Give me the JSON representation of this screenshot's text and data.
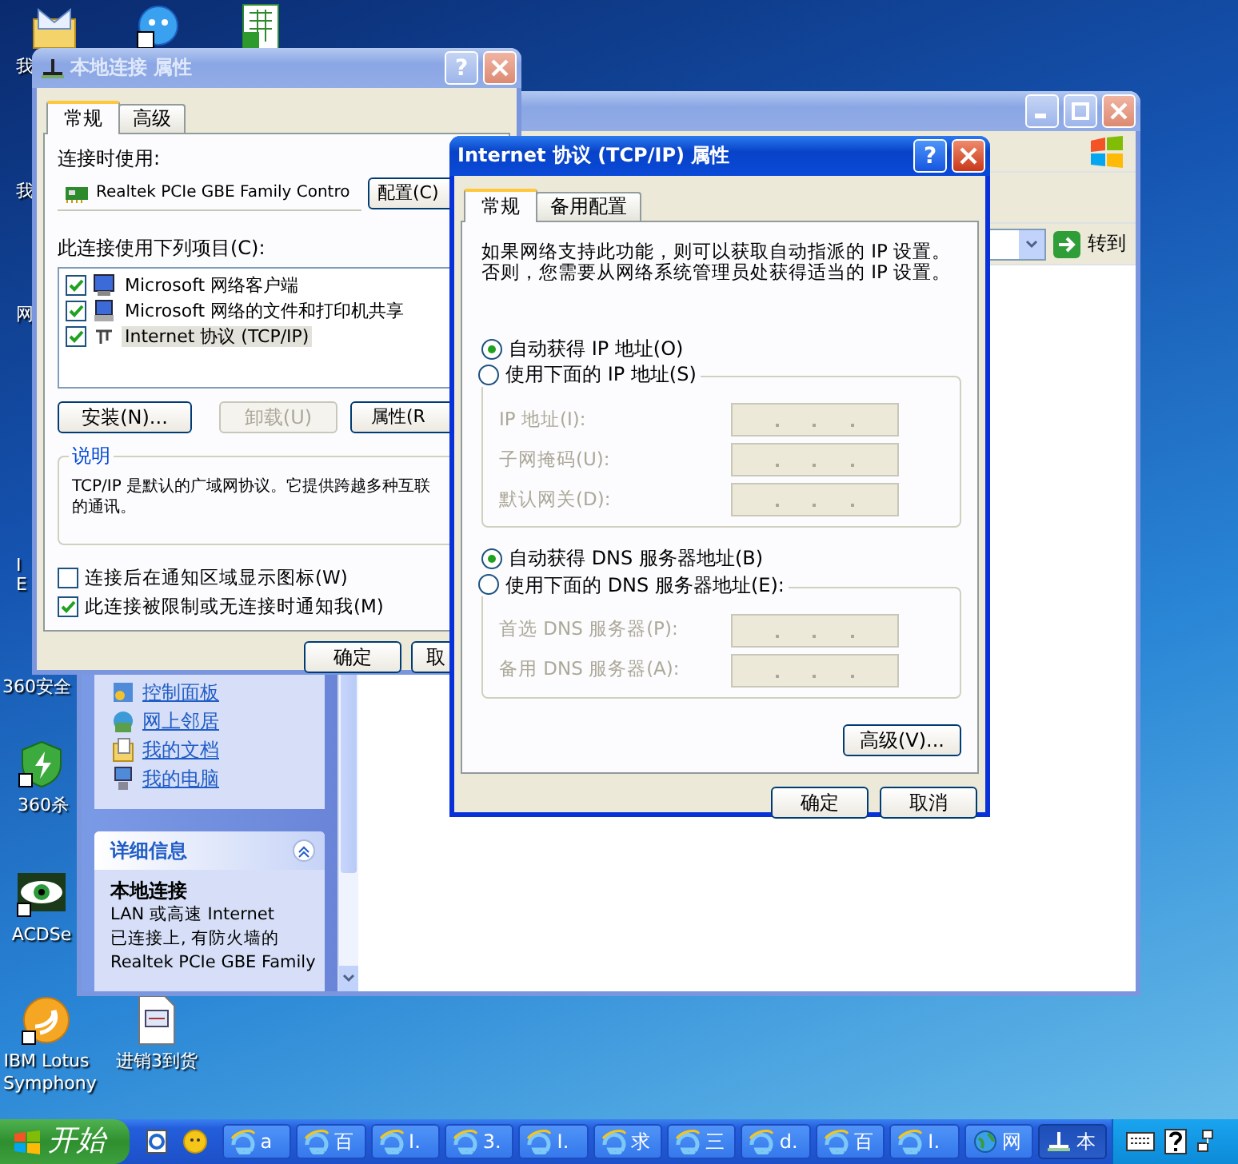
{
  "desktop": {
    "edge_labels": [
      "我",
      "我",
      "网",
      "I",
      "E"
    ],
    "icons": [
      {
        "label": "360安全",
        "kind": "hidden"
      },
      {
        "label": "360杀",
        "kind": "shield"
      },
      {
        "label": "ACDSe",
        "kind": "eye"
      },
      {
        "label": "IBM Lotus Symphony",
        "kind": "lotus"
      },
      {
        "label": "进销3到货",
        "kind": "document"
      }
    ]
  },
  "explorer": {
    "active": false,
    "go_button": "转到",
    "tasks": [
      {
        "label": "控制面板",
        "kind": "control_panel"
      },
      {
        "label": "网上邻居",
        "kind": "network"
      },
      {
        "label": "我的文档",
        "kind": "documents"
      },
      {
        "label": "我的电脑",
        "kind": "computer"
      }
    ],
    "details": {
      "title": "详细信息",
      "expanded": true,
      "name": "本地连接",
      "lines": [
        "LAN 或高速 Internet",
        "已连接上, 有防火墙的",
        "Realtek PCIe GBE Family"
      ]
    }
  },
  "connection_dialog": {
    "active": false,
    "title": "本地连接 属性",
    "help_button": "?",
    "tabs": [
      {
        "label": "常规",
        "selected": true
      },
      {
        "label": "高级",
        "selected": false
      }
    ],
    "connect_using_label": "连接时使用:",
    "adapter": "Realtek PCIe GBE Family Contro",
    "configure_button": "配置(C)",
    "components_label": "此连接使用下列项目(C):",
    "components": [
      {
        "label": "Microsoft 网络客户端",
        "checked": true,
        "selected": false,
        "kind": "client"
      },
      {
        "label": "Microsoft 网络的文件和打印机共享",
        "checked": true,
        "selected": false,
        "kind": "sharing"
      },
      {
        "label": "Internet 协议 (TCP/IP)",
        "checked": true,
        "selected": true,
        "kind": "protocol"
      }
    ],
    "buttons": [
      {
        "label": "安装(N)...",
        "disabled": false
      },
      {
        "label": "卸载(U)",
        "disabled": true
      },
      {
        "label": "属性(R",
        "disabled": false
      }
    ],
    "description_legend": "说明",
    "description_lines": [
      "TCP/IP 是默认的广域网协议。它提供跨越多种互联",
      "的通讯。"
    ],
    "options": [
      {
        "label": "连接后在通知区域显示图标(W)",
        "checked": false
      },
      {
        "label": "此连接被限制或无连接时通知我(M)",
        "checked": true
      }
    ],
    "ok_button": "确定",
    "cancel_button": "取"
  },
  "tcpip_dialog": {
    "active": true,
    "title": "Internet 协议 (TCP/IP) 属性",
    "help_button": "?",
    "tabs": [
      {
        "label": "常规",
        "selected": true
      },
      {
        "label": "备用配置",
        "selected": false
      }
    ],
    "intro": "如果网络支持此功能，则可以获取自动指派的 IP 设置。否则，您需要从网络系统管理员处获得适当的 IP 设置。",
    "ip_mode": [
      {
        "label": "自动获得 IP 地址(O)",
        "selected": true
      },
      {
        "label": "使用下面的 IP 地址(S)",
        "selected": false
      }
    ],
    "ip_fields": [
      {
        "label": "IP 地址(I):",
        "disabled": true
      },
      {
        "label": "子网掩码(U):",
        "disabled": true
      },
      {
        "label": "默认网关(D):",
        "disabled": true
      }
    ],
    "dns_mode": [
      {
        "label": "自动获得 DNS 服务器地址(B)",
        "selected": true
      },
      {
        "label": "使用下面的 DNS 服务器地址(E):",
        "selected": false
      }
    ],
    "dns_fields": [
      {
        "label": "首选 DNS 服务器(P):",
        "disabled": true
      },
      {
        "label": "备用 DNS 服务器(A):",
        "disabled": true
      }
    ],
    "advanced_button": "高级(V)...",
    "ok_button": "确定",
    "cancel_button": "取消"
  },
  "taskbar": {
    "start": "开始",
    "tasks": [
      {
        "label": "a",
        "kind": "ie",
        "selected": false
      },
      {
        "label": "百",
        "kind": "ie",
        "selected": false
      },
      {
        "label": "I.",
        "kind": "ie",
        "selected": false
      },
      {
        "label": "3.",
        "kind": "ie",
        "selected": false
      },
      {
        "label": "I.",
        "kind": "ie",
        "selected": false
      },
      {
        "label": "求",
        "kind": "ie",
        "selected": false
      },
      {
        "label": "三",
        "kind": "ie",
        "selected": false
      },
      {
        "label": "d.",
        "kind": "ie",
        "selected": false
      },
      {
        "label": "百",
        "kind": "ie",
        "selected": false
      },
      {
        "label": "I.",
        "kind": "ie",
        "selected": false
      },
      {
        "label": "网",
        "kind": "network",
        "selected": false
      },
      {
        "label": "本",
        "kind": "connection",
        "selected": true
      }
    ]
  }
}
